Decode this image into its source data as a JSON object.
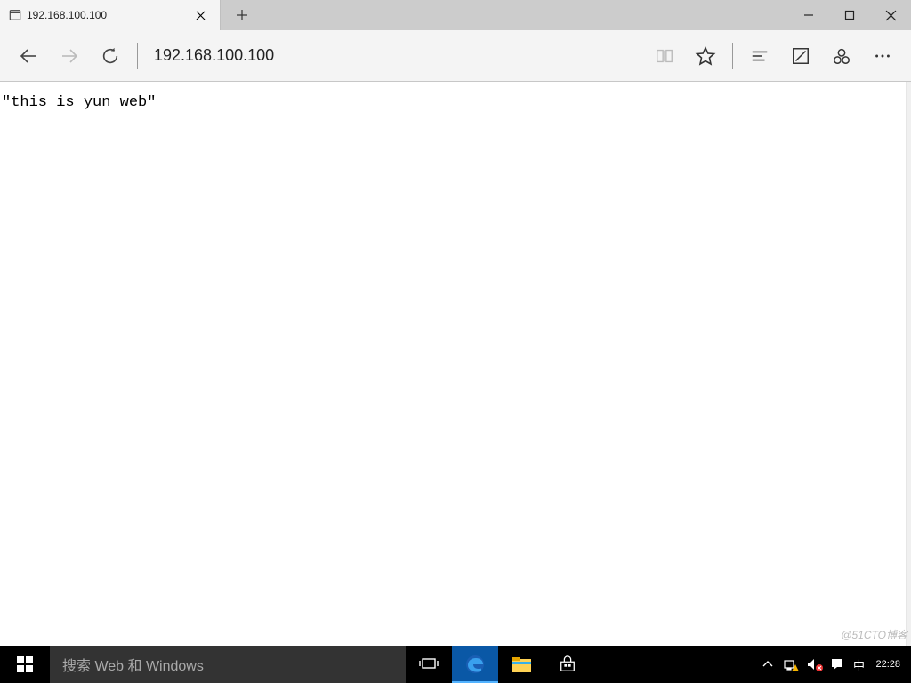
{
  "tab": {
    "title": "192.168.100.100"
  },
  "address": {
    "url": "192.168.100.100"
  },
  "page": {
    "body_text": "\"this is yun web\""
  },
  "watermark": "@51CTO博客",
  "taskbar": {
    "search_placeholder": "搜索 Web 和 Windows",
    "ime": "中",
    "clock": {
      "time": "22:28",
      "date": ""
    }
  }
}
